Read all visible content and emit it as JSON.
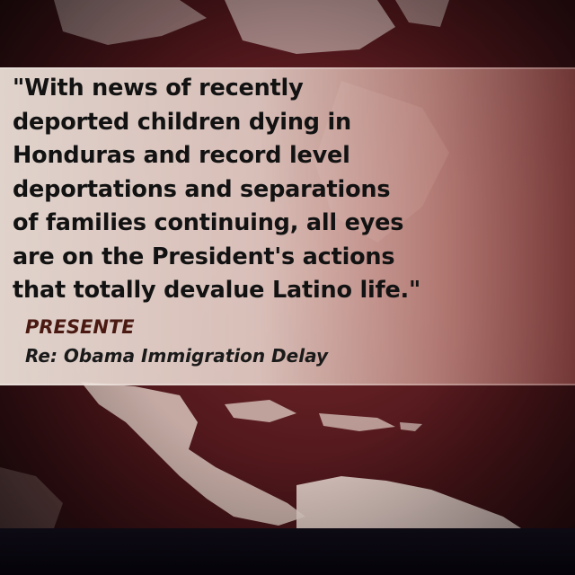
{
  "quote": {
    "lines": [
      "\"With news of recently",
      "deported children dying in",
      "Honduras and record level",
      "deportations and separations",
      "of families continuing, all eyes",
      "are on the President's actions",
      "that totally devalue Latino life.\""
    ]
  },
  "attribution": {
    "organization": "PRESENTE",
    "subject": "Re: Obama Immigration Delay"
  },
  "colors": {
    "background": "#4a1519",
    "panel": "#eee2da",
    "text": "#121212",
    "organization": "#4a1a12"
  }
}
